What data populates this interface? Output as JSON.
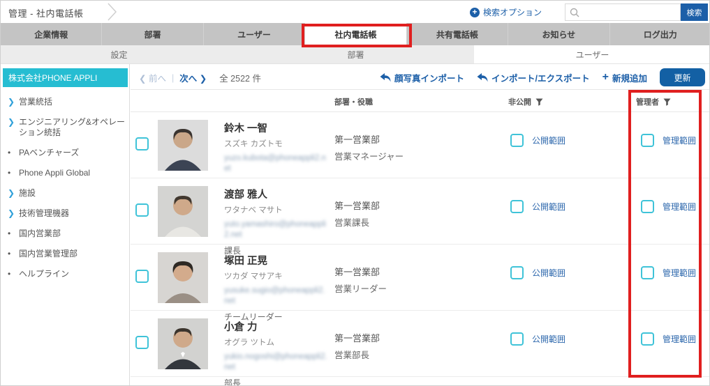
{
  "header": {
    "title": "管理 - 社内電話帳",
    "search_options_label": "検索オプション",
    "search_placeholder": "",
    "search_button_label": "検索"
  },
  "tabs": [
    {
      "label": "企業情報"
    },
    {
      "label": "部署"
    },
    {
      "label": "ユーザー"
    },
    {
      "label": "社内電話帳",
      "active": true
    },
    {
      "label": "共有電話帳"
    },
    {
      "label": "お知らせ"
    },
    {
      "label": "ログ出力"
    }
  ],
  "subtabs": [
    {
      "label": "設定"
    },
    {
      "label": "部署"
    },
    {
      "label": "ユーザー",
      "active": true
    }
  ],
  "sidebar": {
    "company": "株式会社PHONE APPLI",
    "items": [
      {
        "label": "営業統括",
        "type": "expandable"
      },
      {
        "label": "エンジニアリング&オペレーション統括",
        "type": "expandable"
      },
      {
        "label": "PAベンチャーズ",
        "type": "leaf"
      },
      {
        "label": "Phone Appli Global",
        "type": "leaf"
      },
      {
        "label": "施設",
        "type": "expandable"
      },
      {
        "label": "技術管理機器",
        "type": "expandable"
      },
      {
        "label": "国内営業部",
        "type": "leaf"
      },
      {
        "label": "国内営業管理部",
        "type": "leaf"
      },
      {
        "label": "ヘルプライン",
        "type": "leaf"
      }
    ]
  },
  "toolbar": {
    "prev_label": "前へ",
    "next_label": "次へ",
    "total_label": "全 2522 件",
    "photo_import_label": "顔写真インポート",
    "import_export_label": "インポート/エクスポート",
    "add_new_label": "新規追加",
    "update_label": "更新"
  },
  "table": {
    "headers": {
      "dept_role": "部署・役職",
      "private": "非公開",
      "admin": "管理者"
    },
    "public_scope_label": "公開範囲",
    "admin_scope_label": "管理範囲",
    "rows": [
      {
        "name": "鈴木 一智",
        "kana": "スズキ カズトモ",
        "email": "yuzo.kubota@phoneappli2.net",
        "title": "",
        "dept": "第一営業部",
        "role": "営業マネージャー"
      },
      {
        "name": "渡部 雅人",
        "kana": "ワタナベ マサト",
        "email": "yuto.yamashiro@phoneappli2.net",
        "title": "課長",
        "dept": "第一営業部",
        "role": "営業課長"
      },
      {
        "name": "塚田 正晃",
        "kana": "ツカダ マサアキ",
        "email": "yusuke.sugio@phoneappli2.net",
        "title": "チームリーダー",
        "dept": "第一営業部",
        "role": "営業リーダー"
      },
      {
        "name": "小倉 力",
        "kana": "オグラ ツトム",
        "email": "yukio.nogoshi@phoneappli2.net",
        "title": "部長",
        "dept": "第一営業部",
        "role": "営業部長"
      }
    ]
  },
  "colors": {
    "accent_blue": "#1c5fa8",
    "tab_gray": "#c4c4c4",
    "sidebar_teal": "#26bdd2",
    "checkbox_cyan": "#3fc3d8",
    "annotation_red": "#e01f1f",
    "update_button_blue": "#1360a4"
  }
}
